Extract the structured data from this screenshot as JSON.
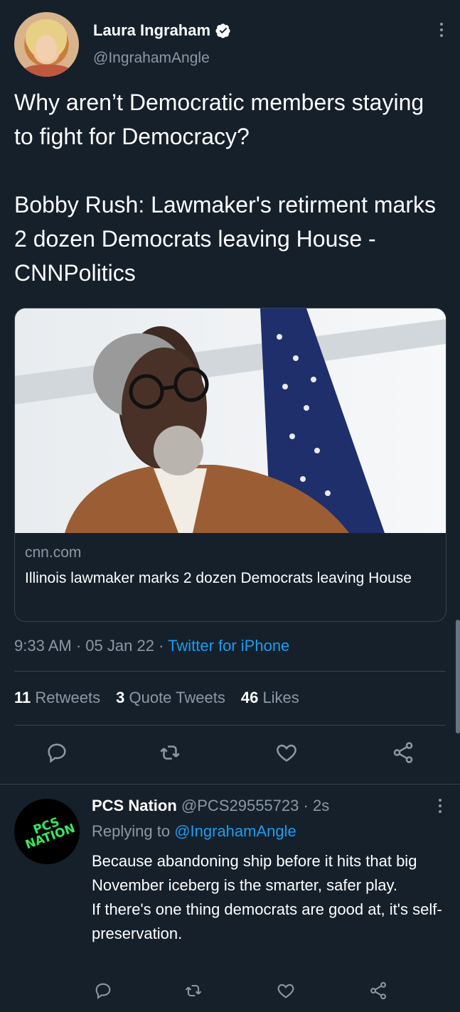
{
  "colors": {
    "background": "#15202b",
    "accent": "#1d9bf0",
    "muted": "#8b98a5",
    "divider": "#38444d"
  },
  "tweet": {
    "author_name": "Laura Ingraham",
    "author_handle": "@IngrahamAngle",
    "text": "Why aren’t Democratic members staying to fight for Democracy?\n\nBobby Rush: Lawmaker's retirment marks 2 dozen Democrats leaving House - CNNPolitics",
    "card": {
      "domain": "cnn.com",
      "title": "Illinois lawmaker marks 2 dozen Democrats leaving House",
      "image_icon": "news-photo"
    },
    "time": "9:33 AM",
    "date": "05 Jan 22",
    "source": "Twitter for iPhone",
    "sep": "·",
    "stats": {
      "retweets_count": "11",
      "retweets_label": "Retweets",
      "quotes_count": "3",
      "quotes_label": "Quote Tweets",
      "likes_count": "46",
      "likes_label": "Likes"
    },
    "actions": [
      "reply-icon",
      "retweet-icon",
      "like-icon",
      "share-icon"
    ]
  },
  "reply": {
    "author_name": "PCS Nation",
    "author_handle": "@PCS29555723",
    "sep": "·",
    "age": "2s",
    "replying_prefix": "Replying to",
    "replying_to": "@IngrahamAngle",
    "avatar_text": "PCS NATION",
    "text": "Because abandoning ship before it hits that big November iceberg is the smarter, safer play.\nIf there's one thing democrats are good at, it's self-preservation.",
    "actions": [
      "reply-icon",
      "retweet-icon",
      "like-icon",
      "share-icon"
    ]
  }
}
